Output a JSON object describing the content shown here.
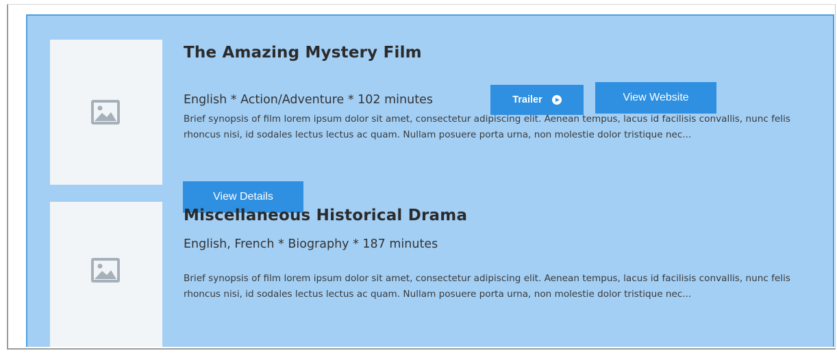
{
  "films": [
    {
      "title": "The Amazing Mystery Film",
      "meta": "English * Action/Adventure * 102 minutes",
      "synopsis": "Brief synopsis of film lorem ipsum dolor sit amet, consectetur adipiscing elit. Aenean tempus, lacus id facilisis convallis, nunc felis rhoncus nisi, id sodales lectus lectus ac quam. Nullam posuere porta urna, non molestie dolor tristique nec...",
      "trailer_label": "Trailer",
      "website_label": "View Website",
      "details_label": "View Details",
      "thumbnail_icon": "image-placeholder-icon"
    },
    {
      "title": "Miscellaneous Historical Drama",
      "meta": "English, French * Biography * 187 minutes",
      "synopsis": "Brief synopsis of film lorem ipsum dolor sit amet, consectetur adipiscing elit. Aenean tempus, lacus id facilisis convallis, nunc felis rhoncus nisi, id sodales lectus lectus ac quam. Nullam posuere porta urna, non molestie dolor tristique nec...",
      "thumbnail_icon": "image-placeholder-icon"
    }
  ],
  "colors": {
    "panel_background": "#a3cff5",
    "panel_border": "#4a9fe0",
    "button": "#2f8fe0",
    "thumbnail_background": "#f2f5f8",
    "placeholder_icon": "#a6b0ba"
  }
}
